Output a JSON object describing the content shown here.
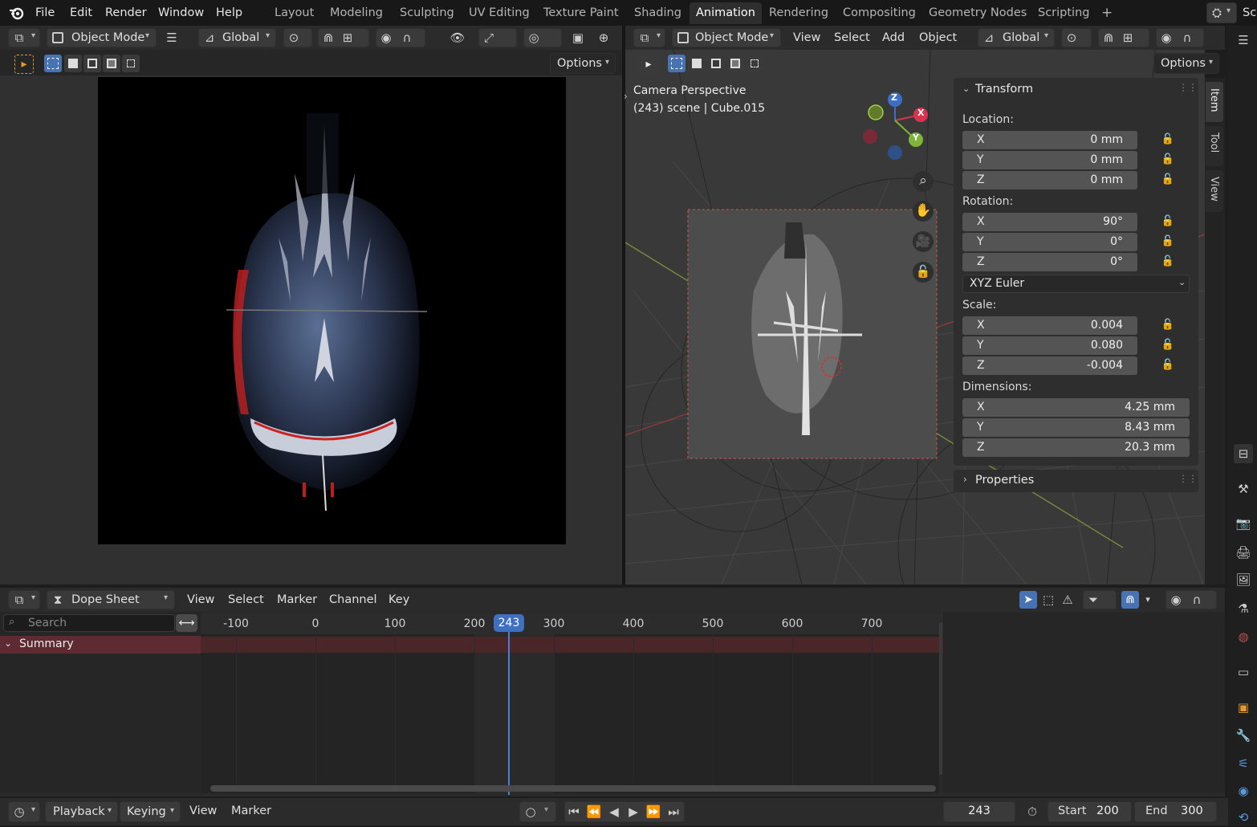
{
  "topbar": {
    "menus": [
      "File",
      "Edit",
      "Render",
      "Window",
      "Help"
    ],
    "workspaces": [
      "Layout",
      "Modeling",
      "Sculpting",
      "UV Editing",
      "Texture Paint",
      "Shading",
      "Animation",
      "Rendering",
      "Compositing",
      "Geometry Nodes",
      "Scripting"
    ],
    "active_workspace": "Animation",
    "add_tab": "+",
    "scene_label": "Sc"
  },
  "left_view": {
    "mode": "Object Mode",
    "orientation": "Global",
    "options": "Options"
  },
  "right_view": {
    "mode": "Object Mode",
    "menus": [
      "View",
      "Select",
      "Add",
      "Object"
    ],
    "orientation": "Global",
    "options": "Options",
    "camera_label": "Camera Perspective",
    "scene_info": "(243) scene | Cube.015",
    "gizmo": {
      "x": "X",
      "y": "Y",
      "z": "Z"
    }
  },
  "transform": {
    "title": "Transform",
    "location_label": "Location:",
    "location": [
      {
        "axis": "X",
        "value": "0 mm"
      },
      {
        "axis": "Y",
        "value": "0 mm"
      },
      {
        "axis": "Z",
        "value": "0 mm"
      }
    ],
    "rotation_label": "Rotation:",
    "rotation": [
      {
        "axis": "X",
        "value": "90°"
      },
      {
        "axis": "Y",
        "value": "0°"
      },
      {
        "axis": "Z",
        "value": "0°"
      }
    ],
    "rotation_mode": "XYZ Euler",
    "scale_label": "Scale:",
    "scale": [
      {
        "axis": "X",
        "value": "0.004"
      },
      {
        "axis": "Y",
        "value": "0.080"
      },
      {
        "axis": "Z",
        "value": "-0.004"
      }
    ],
    "dimensions_label": "Dimensions:",
    "dimensions": [
      {
        "axis": "X",
        "value": "4.25 mm"
      },
      {
        "axis": "Y",
        "value": "8.43 mm"
      },
      {
        "axis": "Z",
        "value": "20.3 mm"
      }
    ],
    "properties": "Properties"
  },
  "ntabs": [
    "Item",
    "Tool",
    "View"
  ],
  "dopesheet": {
    "editor": "Dope Sheet",
    "menus": [
      "View",
      "Select",
      "Marker",
      "Channel",
      "Key"
    ],
    "search_placeholder": "Search",
    "summary": "Summary",
    "ticks": [
      "-100",
      "0",
      "100",
      "200",
      "300",
      "400",
      "500",
      "600",
      "700"
    ],
    "current_frame": "243"
  },
  "timeline": {
    "menus": [
      "Playback",
      "Keying",
      "View",
      "Marker"
    ],
    "frame": "243",
    "start_label": "Start",
    "start": "200",
    "end_label": "End",
    "end": "300"
  }
}
